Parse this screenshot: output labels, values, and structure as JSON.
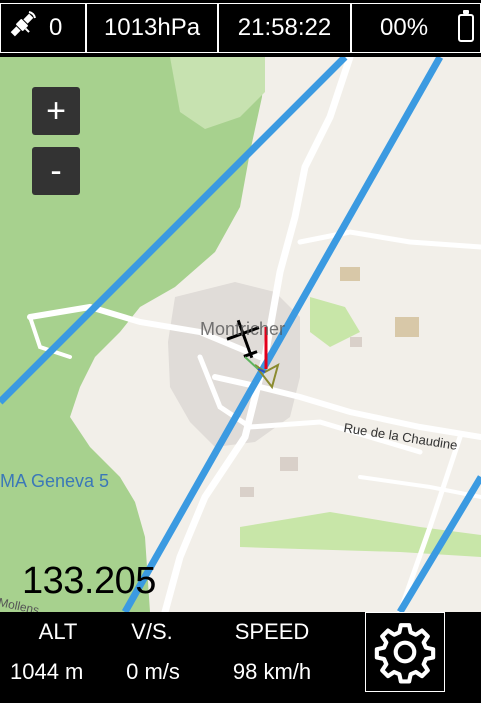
{
  "status": {
    "satellite_icon": "satellite-icon",
    "satellite_count": "0",
    "pressure": "1013hPa",
    "time": "21:58:22",
    "battery_percent": "00%",
    "battery_icon": "battery-icon"
  },
  "map": {
    "zoom_in_label": "+",
    "zoom_out_label": "-",
    "town_label": "Montricher",
    "street_label": "Rue de la Chaudine",
    "airspace_label": "MA Geneva 5",
    "edge_label": "Mollens",
    "frequency": "133.205",
    "colors": {
      "forest": "#a7d18e",
      "land": "#f2efe9",
      "road": "#ffffff",
      "airspace_line": "#3b9ae1",
      "heading_red": "#e3001b"
    }
  },
  "flight": {
    "alt_label": "ALT",
    "alt_value": "1044 m",
    "vs_label": "V/S.",
    "vs_value": "0 m/s",
    "speed_label": "SPEED",
    "speed_value": "98 km/h",
    "settings_icon": "gear-icon"
  }
}
